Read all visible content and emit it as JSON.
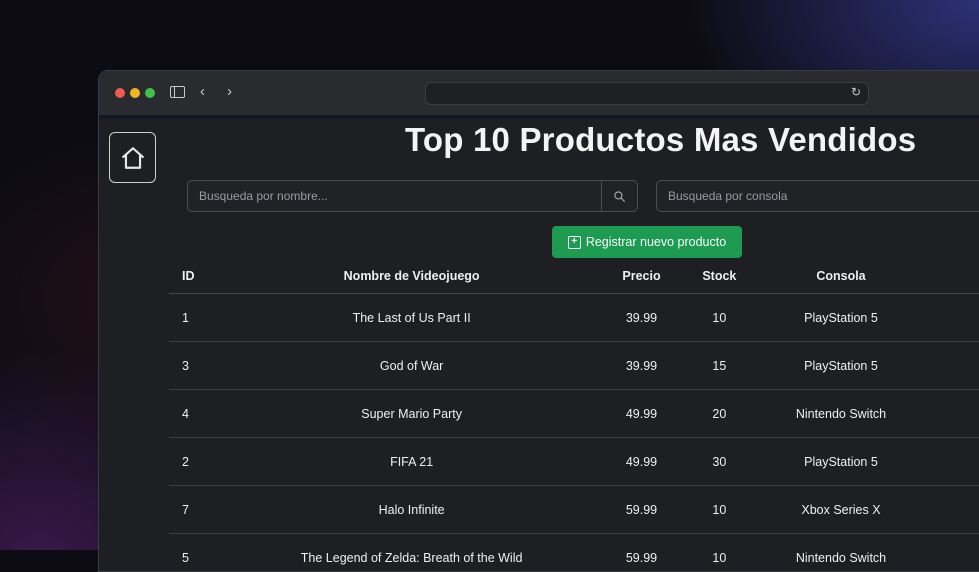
{
  "browser": {
    "url": "",
    "icons": {
      "sidebar": "sidebar-toggle-icon",
      "back": "chevron-left-icon",
      "forward": "chevron-right-icon",
      "reload": "reload-icon"
    }
  },
  "nav": {
    "home_icon": "home-icon"
  },
  "page": {
    "title": "Top 10 Productos Mas Vendidos"
  },
  "search": {
    "name_placeholder": "Busqueda por nombre...",
    "console_placeholder": "Busqueda por consola",
    "search_icon": "search-icon"
  },
  "actions": {
    "register_label": "Registrar nuevo producto",
    "register_color": "#1f9a52"
  },
  "table": {
    "headers": {
      "id": "ID",
      "name": "Nombre de Videojuego",
      "price": "Precio",
      "stock": "Stock",
      "console": "Consola"
    },
    "rows": [
      {
        "id": "1",
        "name": "The Last of Us Part II",
        "price": "39.99",
        "stock": "10",
        "console": "PlayStation 5"
      },
      {
        "id": "3",
        "name": "God of War",
        "price": "39.99",
        "stock": "15",
        "console": "PlayStation 5"
      },
      {
        "id": "4",
        "name": "Super Mario Party",
        "price": "49.99",
        "stock": "20",
        "console": "Nintendo Switch"
      },
      {
        "id": "2",
        "name": "FIFA 21",
        "price": "49.99",
        "stock": "30",
        "console": "PlayStation 5"
      },
      {
        "id": "7",
        "name": "Halo Infinite",
        "price": "59.99",
        "stock": "10",
        "console": "Xbox Series X"
      },
      {
        "id": "5",
        "name": "The Legend of Zelda: Breath of the Wild",
        "price": "59.99",
        "stock": "10",
        "console": "Nintendo Switch"
      }
    ],
    "action_color": "#0d6efd"
  }
}
